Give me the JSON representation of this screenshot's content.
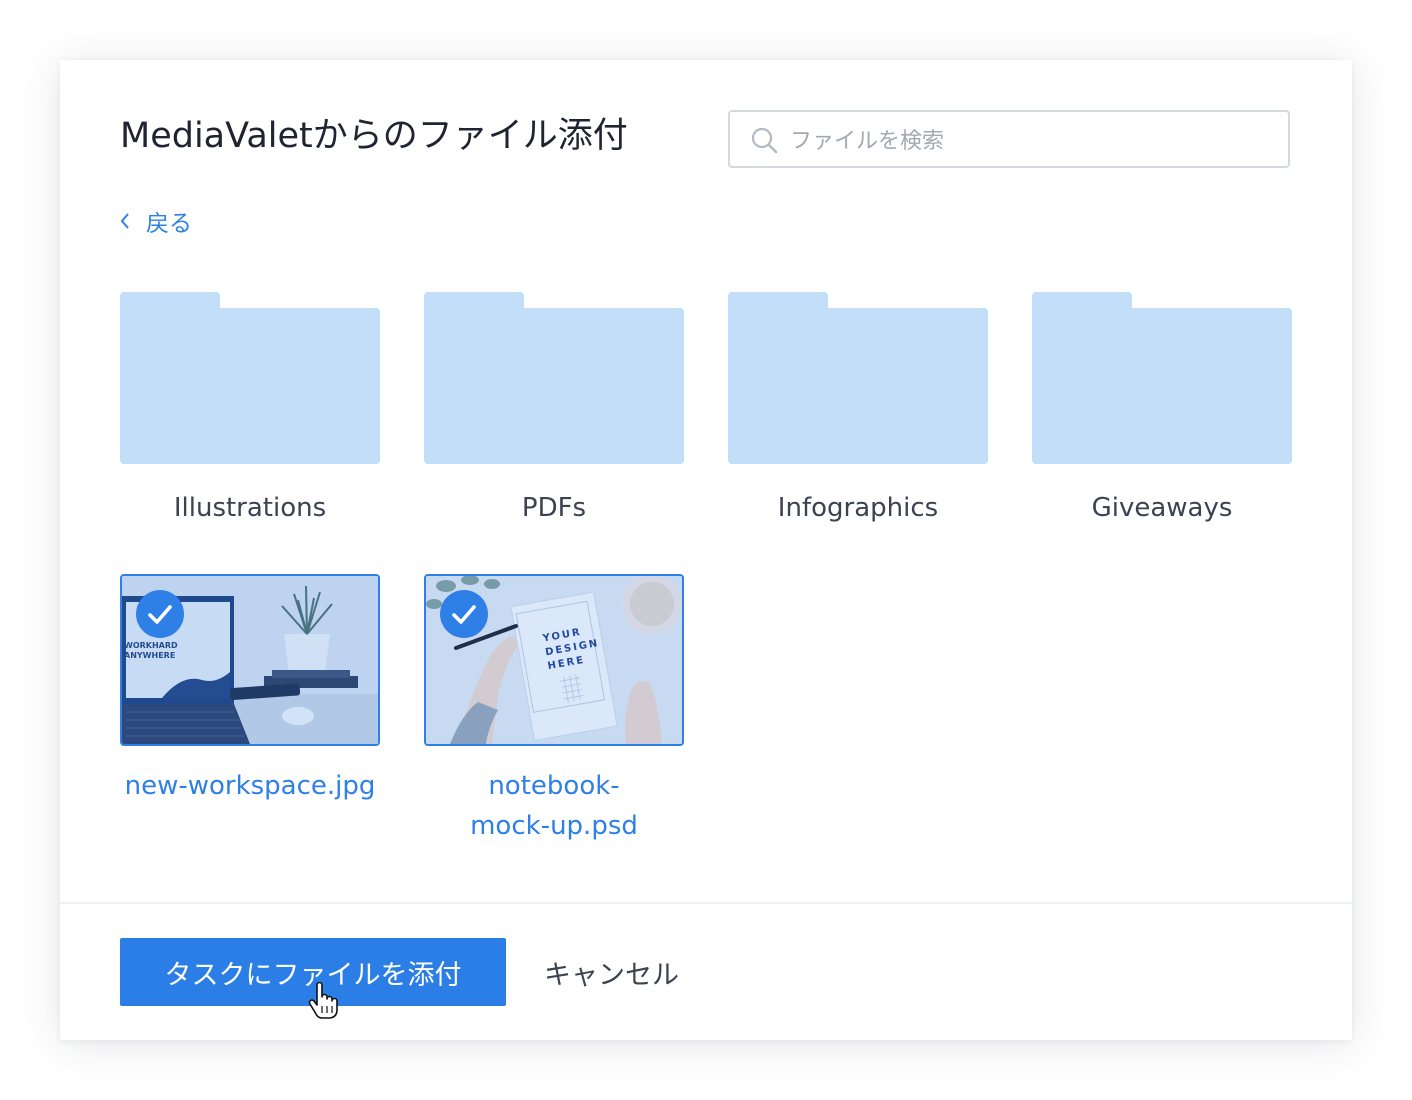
{
  "dialog": {
    "title": "MediaValetからのファイル添付",
    "search": {
      "placeholder": "ファイルを検索",
      "value": "",
      "icon": "search-icon"
    },
    "back": {
      "label": "戻る",
      "icon": "chevron-left-icon"
    }
  },
  "folders": [
    {
      "name": "Illustrations",
      "icon": "folder-icon"
    },
    {
      "name": "PDFs",
      "icon": "folder-icon"
    },
    {
      "name": "Infographics",
      "icon": "folder-icon"
    },
    {
      "name": "Giveaways",
      "icon": "folder-icon"
    }
  ],
  "files": [
    {
      "line1": "new-workspace.jpg",
      "line2": "",
      "selected": true,
      "thumb_text": [
        "WORKHARD",
        "ANYWHERE"
      ]
    },
    {
      "line1": "notebook-",
      "line2": "mock-up.psd",
      "selected": true,
      "thumb_text": [
        "YOUR",
        "DESIGN",
        "HERE"
      ]
    }
  ],
  "footer": {
    "attach_label": "タスクにファイルを添付",
    "cancel_label": "キャンセル"
  },
  "colors": {
    "accent": "#2f80e6",
    "folder": "#c3def8",
    "text": "#3b4250"
  }
}
